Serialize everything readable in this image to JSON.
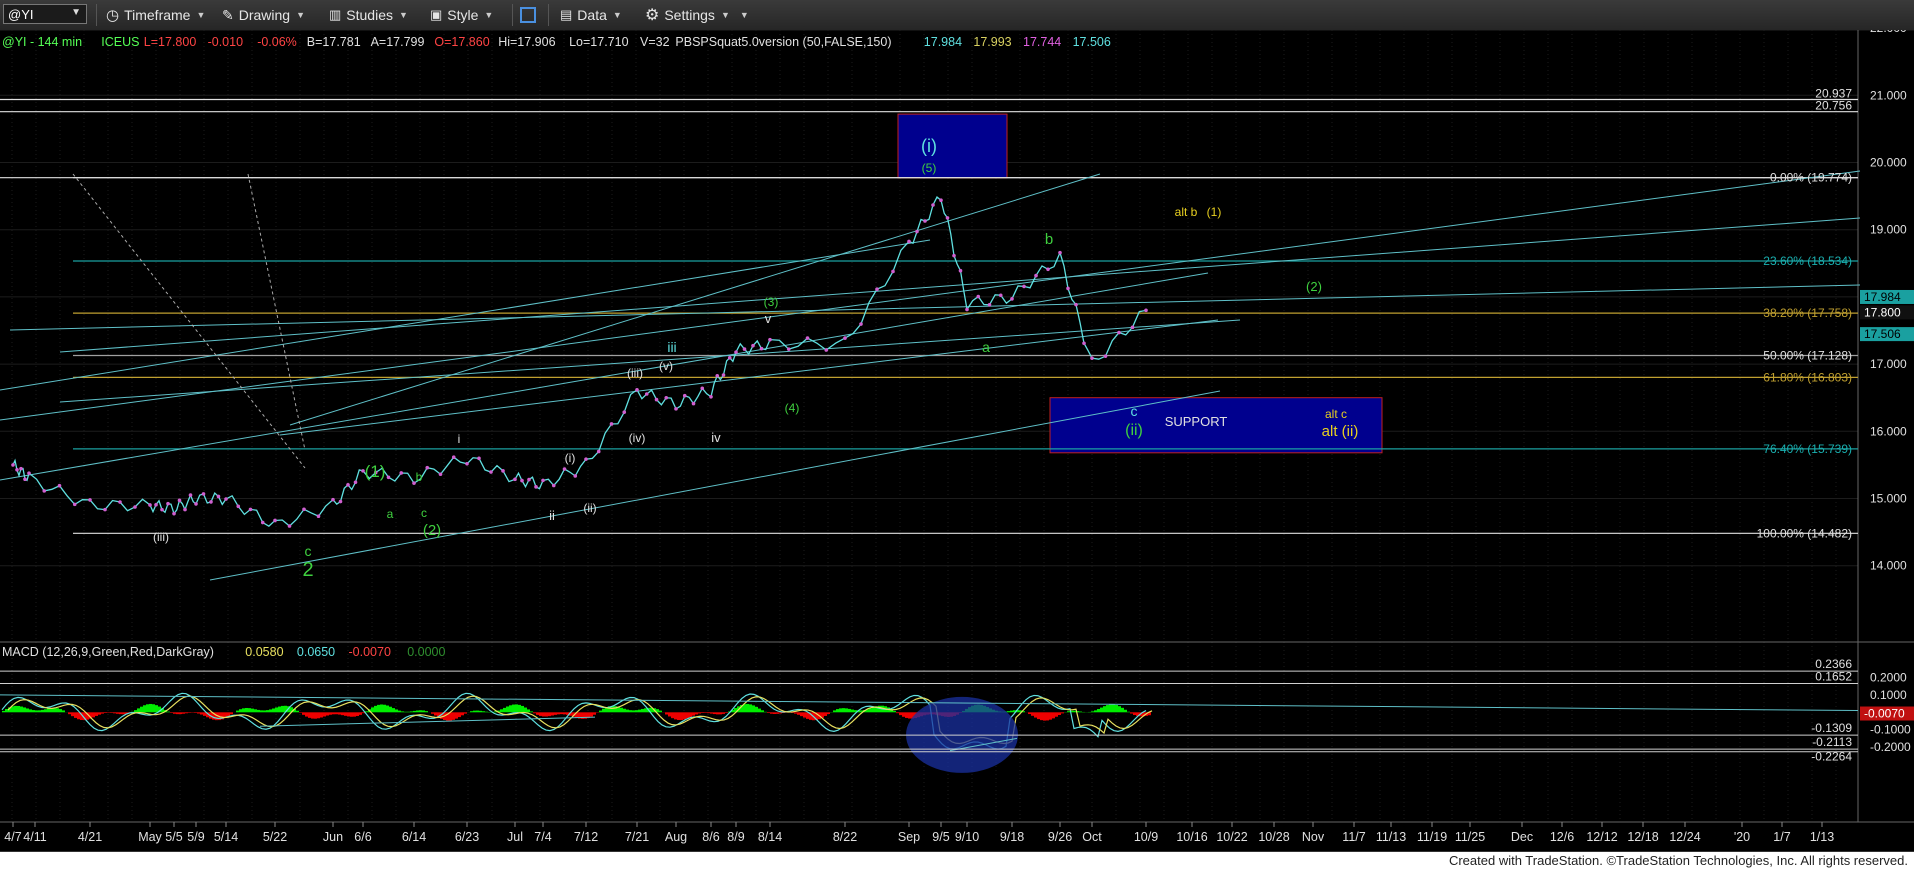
{
  "toolbar": {
    "symbol": "@YI",
    "timeframe": "Timeframe",
    "drawing": "Drawing",
    "studies": "Studies",
    "style": "Style",
    "data": "Data",
    "settings": "Settings"
  },
  "header": [
    {
      "text": "@YI - 144 min",
      "color": "#55ff55"
    },
    {
      "text": "ICEUS",
      "color": "#55ff55"
    },
    {
      "text": "L=17.800",
      "color": "#ff4444"
    },
    {
      "text": "-0.010",
      "color": "#ff4444"
    },
    {
      "text": "-0.06%",
      "color": "#ff4444"
    },
    {
      "text": "B=17.781",
      "color": "#e0e0e0"
    },
    {
      "text": "A=17.799",
      "color": "#e0e0e0"
    },
    {
      "text": "O=17.860",
      "color": "#ff4444"
    },
    {
      "text": "Hi=17.906",
      "color": "#e0e0e0"
    },
    {
      "text": "Lo=17.710",
      "color": "#e0e0e0"
    },
    {
      "text": "V=32",
      "color": "#e0e0e0"
    },
    {
      "text": "PBSPSquat5.0version (50,FALSE,150)",
      "color": "#e0e0e0"
    },
    {
      "text": "17.984",
      "color": "#5fe0e0"
    },
    {
      "text": "17.993",
      "color": "#d8d060"
    },
    {
      "text": "17.744",
      "color": "#e060e0"
    },
    {
      "text": "17.506",
      "color": "#5fe0e0"
    }
  ],
  "macd_header": [
    {
      "text": "MACD (12,26,9,Green,Red,DarkGray)",
      "color": "#e0e0e0"
    },
    {
      "text": "0.0580",
      "color": "#e8e060"
    },
    {
      "text": "0.0650",
      "color": "#5fe0e0"
    },
    {
      "text": "-0.0070",
      "color": "#ff4444"
    },
    {
      "text": "0.0000",
      "color": "#2f8f2f"
    }
  ],
  "price_axis": [
    "22.000",
    "21.000",
    "20.000",
    "19.000",
    "18.000",
    "17.000",
    "16.000",
    "15.000",
    "14.000"
  ],
  "price_tags": [
    {
      "text": "17.984",
      "bg": "#1aa0a0",
      "color": "#000"
    },
    {
      "text": "17.800",
      "bg": "#101010",
      "color": "#fff"
    },
    {
      "text": "17.506",
      "bg": "#1aa0a0",
      "color": "#000"
    }
  ],
  "levels": [
    {
      "text": "20.937"
    },
    {
      "text": "20.756"
    },
    {
      "text": "0.00% (19.774)"
    },
    {
      "text": "23.60% (18.534)"
    },
    {
      "text": "38.20% (17.758)"
    },
    {
      "text": "50.00% (17.128)"
    },
    {
      "text": "61.80% (16.803)"
    },
    {
      "text": "76.40% (15.739)"
    },
    {
      "text": "100.00% (14.482)"
    }
  ],
  "macd_axis": [
    "0.2000",
    "0.1000",
    "-0.1000",
    "-0.2000"
  ],
  "macd_levels": [
    "0.2366",
    "0.1652",
    "-0.1309",
    "-0.2113",
    "-0.2264"
  ],
  "macd_tag": "-0.0070",
  "time_axis": [
    "4/7",
    "4/11",
    "4/21",
    "May",
    "5/5",
    "5/9",
    "5/14",
    "5/22",
    "Jun",
    "6/6",
    "6/14",
    "6/23",
    "Jul",
    "7/4",
    "7/12",
    "7/21",
    "Aug",
    "8/6",
    "8/9",
    "8/14",
    "8/22",
    "Sep",
    "9/5",
    "9/10",
    "9/18",
    "9/26",
    "Oct",
    "10/9",
    "10/16",
    "10/22",
    "10/28",
    "Nov",
    "11/7",
    "11/13",
    "11/19",
    "11/25",
    "Dec",
    "12/6",
    "12/12",
    "12/18",
    "12/24",
    "'20",
    "1/7",
    "1/13"
  ],
  "wave_labels": [
    {
      "text": "(i)",
      "color": "#5fe0e0"
    },
    {
      "text": "(5)",
      "color": "#3fd03f"
    },
    {
      "text": "alt b",
      "color": "#e8d020"
    },
    {
      "text": "(1)",
      "color": "#e8d020"
    },
    {
      "text": "b",
      "color": "#3fd03f"
    },
    {
      "text": "(2)",
      "color": "#3fd03f"
    },
    {
      "text": "(3)",
      "color": "#3fd03f"
    },
    {
      "text": "v",
      "color": "#e0e0e0"
    },
    {
      "text": "iii",
      "color": "#5fe0e0"
    },
    {
      "text": "(iii)",
      "color": "#e0e0e0"
    },
    {
      "text": "(v)",
      "color": "#e0e0e0"
    },
    {
      "text": "a",
      "color": "#3fd03f"
    },
    {
      "text": "(4)",
      "color": "#3fd03f"
    },
    {
      "text": "(iv)",
      "color": "#e0e0e0"
    },
    {
      "text": "iv",
      "color": "#e0e0e0"
    },
    {
      "text": "c",
      "color": "#5fe0e0"
    },
    {
      "text": "(ii)",
      "color": "#3fd03f"
    },
    {
      "text": "SUPPORT",
      "color": "#e0e0e0"
    },
    {
      "text": "alt c",
      "color": "#e8d020"
    },
    {
      "text": "alt (ii)",
      "color": "#e8d020"
    },
    {
      "text": "i",
      "color": "#e0e0e0"
    },
    {
      "text": "(i)",
      "color": "#e0e0e0"
    },
    {
      "text": "(1)",
      "color": "#3fd03f"
    },
    {
      "text": "b",
      "color": "#3fd03f"
    },
    {
      "text": "a",
      "color": "#3fd03f"
    },
    {
      "text": "c",
      "color": "#3fd03f"
    },
    {
      "text": "(2)",
      "color": "#3fd03f"
    },
    {
      "text": "ii",
      "color": "#e0e0e0"
    },
    {
      "text": "(ii)",
      "color": "#e0e0e0"
    },
    {
      "text": "(iii)",
      "color": "#e0e0e0"
    },
    {
      "text": "c",
      "color": "#3fd03f"
    },
    {
      "text": "2",
      "color": "#3fd03f"
    }
  ],
  "chart_data": {
    "type": "line",
    "title": "@YI - 144 min",
    "price_range": [
      13.5,
      22.3
    ],
    "macd_range": [
      -0.25,
      0.27
    ],
    "x": [
      "4/7",
      "4/11",
      "4/21",
      "May",
      "5/5",
      "5/9",
      "5/14",
      "5/22",
      "Jun",
      "6/6",
      "6/14",
      "6/23",
      "Jul",
      "7/4",
      "7/12",
      "7/21",
      "Aug",
      "8/6",
      "8/9",
      "8/14",
      "8/22",
      "Sep",
      "9/5",
      "9/10",
      "9/18",
      "9/26",
      "Oct",
      "10/9"
    ],
    "series": [
      {
        "values": [
          15.5,
          15.3,
          14.9,
          14.9,
          14.85,
          15.0,
          15.0,
          14.6,
          14.9,
          15.4,
          15.3,
          15.6,
          15.3,
          15.2,
          15.5,
          16.6,
          16.4,
          16.6,
          17.2,
          17.3,
          17.3,
          18.8,
          19.5,
          17.9,
          18.0,
          18.6,
          17.0,
          17.8
        ]
      }
    ],
    "colors": {
      "price": "#5fe0e0",
      "bar_up": "#00ee00",
      "bar_down": "#ee0000",
      "signal": "#e8e060",
      "fib": "#a09060",
      "support": "#00008e"
    }
  },
  "footer": "Created with TradeStation. ©TradeStation Technologies, Inc. All rights reserved."
}
